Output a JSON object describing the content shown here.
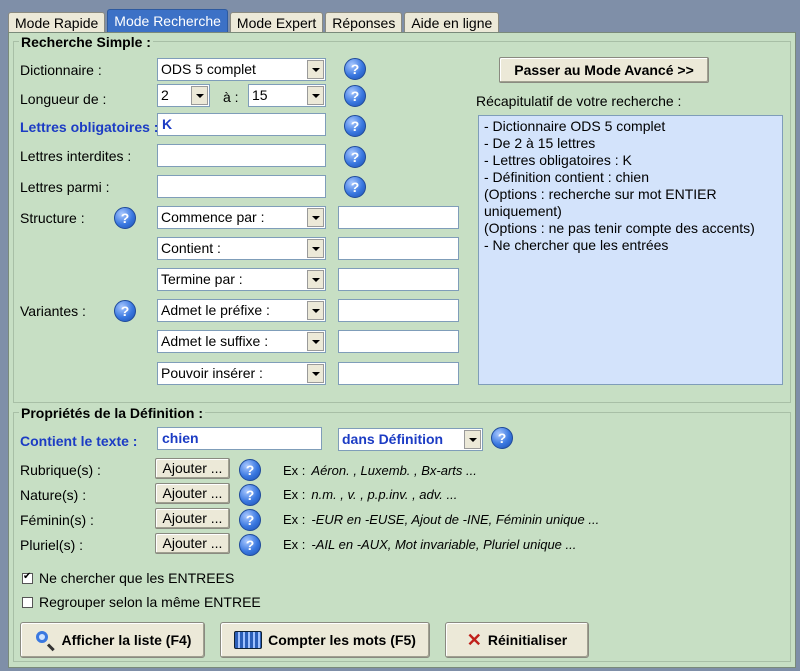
{
  "tabs": [
    "Mode Rapide",
    "Mode Recherche",
    "Mode Expert",
    "Réponses",
    "Aide en ligne"
  ],
  "simple": {
    "title": "Recherche Simple :",
    "dictionnaire_label": "Dictionnaire :",
    "dictionnaire_value": "ODS 5 complet",
    "longueur_label": "Longueur de :",
    "longueur_from": "2",
    "longueur_a": "à :",
    "longueur_to": "15",
    "obligatoires_label": "Lettres obligatoires :",
    "obligatoires_value": "K",
    "interdites_label": "Lettres interdites :",
    "interdites_value": "",
    "parmi_label": "Lettres parmi :",
    "parmi_value": "",
    "structure_label": "Structure :",
    "variantes_label": "Variantes :",
    "structure_options": [
      "Commence par :",
      "Contient :",
      "Termine par :"
    ],
    "variantes_options": [
      "Admet le préfixe :",
      "Admet le suffixe :",
      "Pouvoir insérer :"
    ],
    "help_glyph": "?",
    "advanced_button": "Passer au Mode Avancé >>",
    "recap_label": "Récapitulatif de votre recherche :",
    "recap_lines": [
      "- Dictionnaire ODS 5 complet",
      "- De 2 à 15 lettres",
      "- Lettres obligatoires : K",
      "- Définition contient : chien",
      "(Options : recherche sur mot ENTIER uniquement)",
      "(Options : ne pas tenir compte des accents)",
      "- Ne chercher que les entrées"
    ]
  },
  "definition": {
    "title": "Propriétés de la Définition :",
    "contient_label": "Contient le texte :",
    "contient_value": "chien",
    "scope_value": "dans Définition",
    "add_label": "Ajouter ...",
    "rows": [
      {
        "label": "Rubrique(s) :",
        "ex_prefix": "Ex :",
        "example": "Aéron. , Luxemb. , Bx-arts ..."
      },
      {
        "label": "Nature(s) :",
        "ex_prefix": "Ex :",
        "example": "n.m. , v. , p.p.inv. , adv. ..."
      },
      {
        "label": "Féminin(s) :",
        "ex_prefix": "Ex :",
        "example": "-EUR en -EUSE, Ajout de -INE, Féminin unique ..."
      },
      {
        "label": "Pluriel(s) :",
        "ex_prefix": "Ex :",
        "example": "-AIL en -AUX, Mot invariable, Pluriel unique ..."
      }
    ],
    "check_entrees": "Ne chercher que les ENTREES",
    "check_regrouper": "Regrouper selon la même ENTREE"
  },
  "actions": {
    "afficher": "Afficher la liste (F4)",
    "compter": "Compter les mots (F5)",
    "reinit": "Réinitialiser"
  }
}
